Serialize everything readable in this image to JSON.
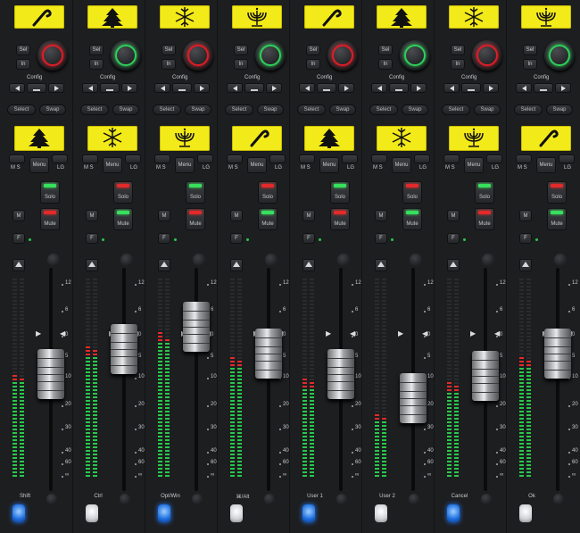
{
  "scale": {
    "labels": [
      "12",
      "6",
      "0",
      "5",
      "10",
      "20",
      "30",
      "40",
      "60",
      "∞"
    ]
  },
  "strips": [
    {
      "top_icon": "candy-cane-icon",
      "knob": "red",
      "lcd_icon": "tree-icon",
      "solo_led": "green",
      "mute_led": "red",
      "bottom_label": "Shift",
      "bottom_color": "blue",
      "fader": 0.48
    },
    {
      "top_icon": "tree-icon",
      "knob": "green",
      "lcd_icon": "snowflake-icon",
      "solo_led": "red",
      "mute_led": "green",
      "bottom_label": "Ctrl",
      "bottom_color": "white",
      "fader": 0.33
    },
    {
      "top_icon": "snowflake-icon",
      "knob": "red",
      "lcd_icon": "menorah-icon",
      "solo_led": "green",
      "mute_led": "red",
      "bottom_label": "Opt/Win",
      "bottom_color": "blue",
      "fader": 0.2
    },
    {
      "top_icon": "menorah-icon",
      "knob": "green",
      "lcd_icon": "candy-cane-icon",
      "solo_led": "red",
      "mute_led": "green",
      "bottom_label": "⌘/Alt",
      "bottom_color": "white",
      "fader": 0.36
    },
    {
      "top_icon": "candy-cane-icon",
      "knob": "red",
      "lcd_icon": "tree-icon",
      "solo_led": "green",
      "mute_led": "red",
      "bottom_label": "User 1",
      "bottom_color": "blue",
      "fader": 0.48
    },
    {
      "top_icon": "tree-icon",
      "knob": "green",
      "lcd_icon": "snowflake-icon",
      "solo_led": "red",
      "mute_led": "green",
      "bottom_label": "User 2",
      "bottom_color": "white",
      "fader": 0.62
    },
    {
      "top_icon": "snowflake-icon",
      "knob": "red",
      "lcd_icon": "menorah-icon",
      "solo_led": "green",
      "mute_led": "red",
      "bottom_label": "Cancel",
      "bottom_color": "blue",
      "fader": 0.49
    },
    {
      "top_icon": "menorah-icon",
      "knob": "green",
      "lcd_icon": "candy-cane-icon",
      "solo_led": "red",
      "mute_led": "green",
      "bottom_label": "Ok",
      "bottom_color": "white",
      "fader": 0.36
    }
  ],
  "labels": {
    "sel": "Sel",
    "in": "In",
    "config": "Config",
    "select": "Select",
    "swap": "Swap",
    "ms": "M S",
    "menu": "Menu",
    "lg": "LG",
    "solo": "Solo",
    "mute": "Mute",
    "m": "M",
    "f": "F"
  },
  "colors": {
    "lcd": "#f3ea1a",
    "led_green": "#37e05c",
    "led_red": "#e32a2a",
    "blue": "#1e6fe0"
  }
}
